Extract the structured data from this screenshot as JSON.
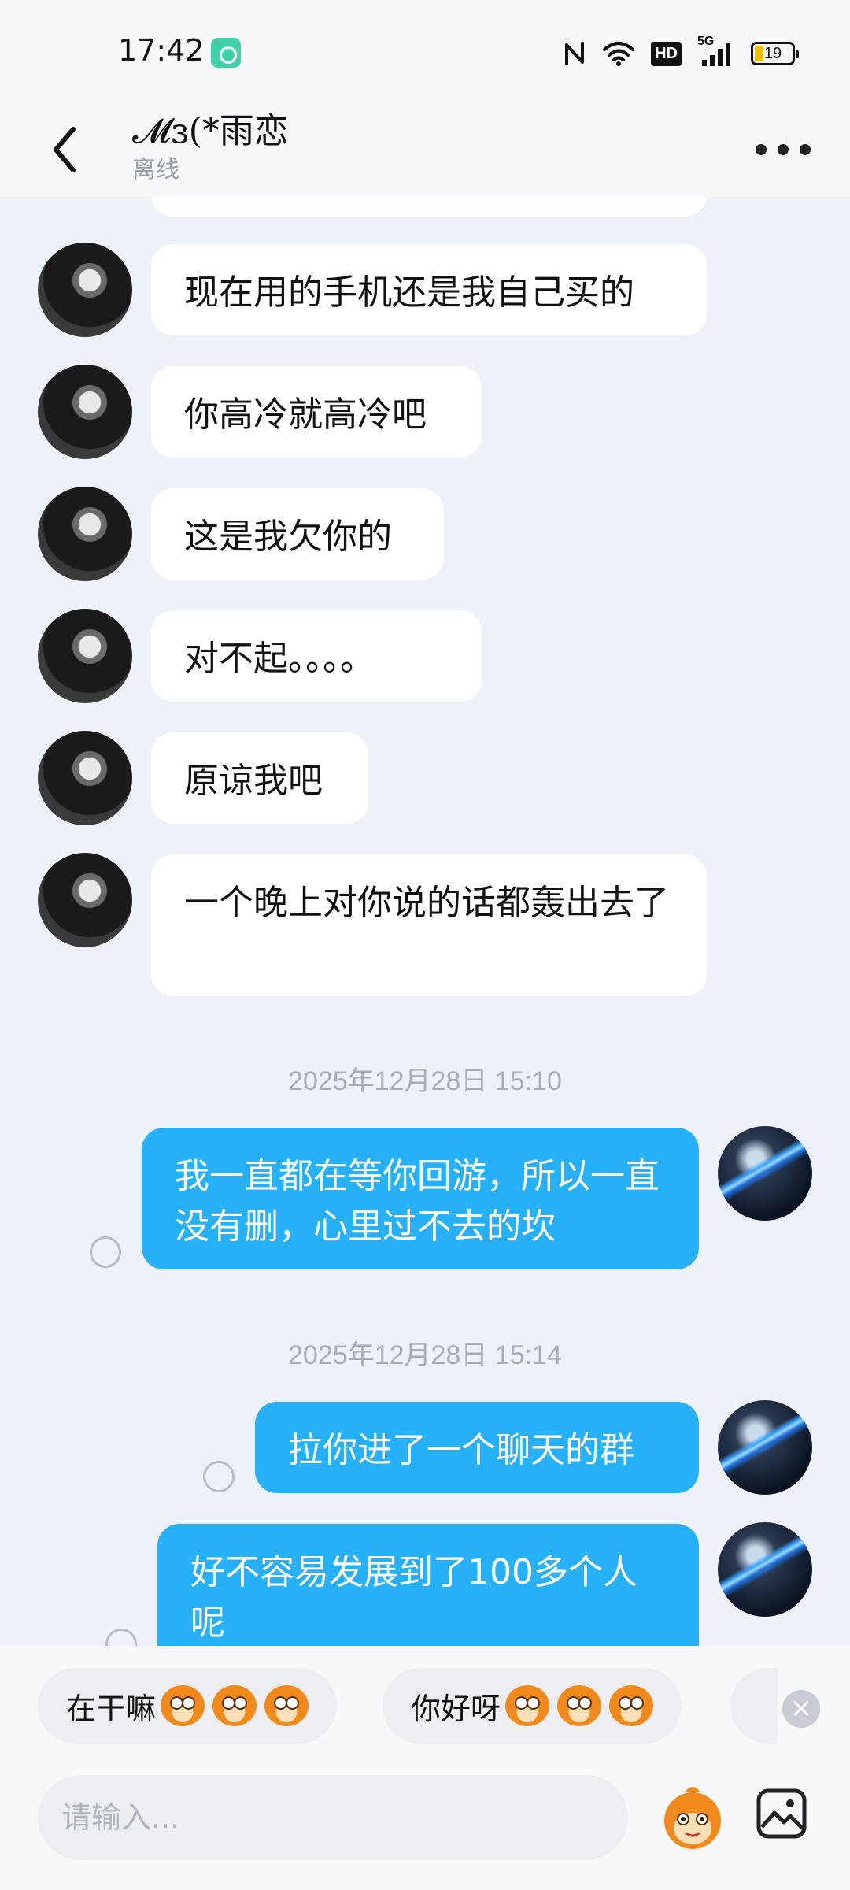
{
  "status_bar": {
    "time": "17:42",
    "network": "5G",
    "hd": "HD",
    "battery": "19",
    "icons": [
      "chat-app-icon",
      "nfc-icon",
      "wifi-icon",
      "hd-icon",
      "signal-icon",
      "battery-icon"
    ]
  },
  "header": {
    "name": "𝓜ɜ(*雨恋",
    "status": "离线",
    "icons": [
      "back-icon",
      "more-icon"
    ]
  },
  "messages": [
    {
      "side": "theirs",
      "text": "现在用的手机还是我自己买的"
    },
    {
      "side": "theirs",
      "text": "你高冷就高冷吧"
    },
    {
      "side": "theirs",
      "text": "这是我欠你的"
    },
    {
      "side": "theirs",
      "text": "对不起。。。。"
    },
    {
      "side": "theirs",
      "text": "原谅我吧"
    },
    {
      "side": "theirs",
      "text": "一个晚上对你说的话都轰出去了"
    },
    {
      "side": "timestamp",
      "text": "2025年12月28日 15:10"
    },
    {
      "side": "mine",
      "text": "我一直都在等你回游，所以一直没有删，心里过不去的坎"
    },
    {
      "side": "timestamp",
      "text": "2025年12月28日 15:14"
    },
    {
      "side": "mine",
      "text": "拉你进了一个聊天的群"
    },
    {
      "side": "mine",
      "text": "好不容易发展到了100多个人呢"
    }
  ],
  "quick_replies": [
    {
      "text": "在干嘛",
      "emoji": "grinning-monkey"
    },
    {
      "text": "你好呀",
      "emoji": "wide-eyed-monkey"
    }
  ],
  "input": {
    "placeholder": "请输入..."
  },
  "toolbar_icons": [
    "sticker-monkey-icon",
    "image-icon",
    "close-icon"
  ],
  "colors": {
    "my_bubble": "#26b0f8",
    "their_bubble": "#ffffff",
    "background": "#eef2f8",
    "timestamp": "#a7acb4"
  }
}
